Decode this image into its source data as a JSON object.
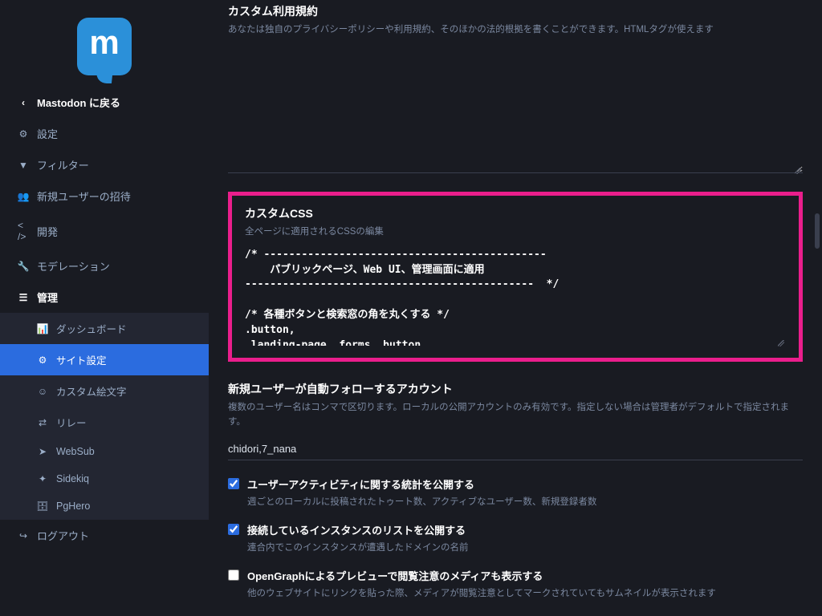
{
  "sidebar": {
    "back": "Mastodon に戻る",
    "settings": "設定",
    "filter": "フィルター",
    "invite": "新規ユーザーの招待",
    "dev": "開発",
    "moderation": "モデレーション",
    "admin": "管理",
    "sub": {
      "dashboard": "ダッシュボード",
      "site": "サイト設定",
      "emoji": "カスタム絵文字",
      "relay": "リレー",
      "websub": "WebSub",
      "sidekiq": "Sidekiq",
      "pghero": "PgHero"
    },
    "logout": "ログアウト"
  },
  "terms": {
    "title": "カスタム利用規約",
    "hint": "あなたは独自のプライバシーポリシーや利用規約、そのほかの法的根拠を書くことができます。HTMLタグが使えます"
  },
  "css": {
    "title": "カスタムCSS",
    "hint": "全ページに適用されるCSSの編集",
    "value": "/* ---------------------------------------------\n    パブリックページ、Web UI、管理画面に適用\n----------------------------------------------  */\n\n/* 各種ボタンと検索窓の角を丸くする */\n.button,\n.landing-page__forms .button,\n.public-layout .header .nav-button,"
  },
  "autofollow": {
    "title": "新規ユーザーが自動フォローするアカウント",
    "hint": "複数のユーザー名はコンマで区切ります。ローカルの公開アカウントのみ有効です。指定しない場合は管理者がデフォルトで指定されます。",
    "value": "chidori,7_nana"
  },
  "checks": [
    {
      "checked": true,
      "label": "ユーザーアクティビティに関する統計を公開する",
      "sub": "週ごとのローカルに投稿されたトゥート数、アクティブなユーザー数、新規登録者数"
    },
    {
      "checked": true,
      "label": "接続しているインスタンスのリストを公開する",
      "sub": "連合内でこのインスタンスが遭遇したドメインの名前"
    },
    {
      "checked": false,
      "label": "OpenGraphによるプレビューで閲覧注意のメディアも表示する",
      "sub": "他のウェブサイトにリンクを貼った際、メディアが閲覧注意としてマークされていてもサムネイルが表示されます"
    }
  ]
}
